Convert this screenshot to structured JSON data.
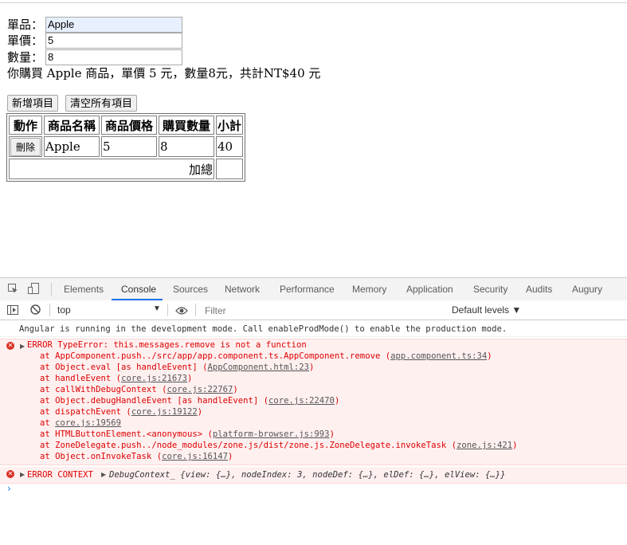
{
  "form": {
    "product_label": "單品：",
    "product_value": "Apple",
    "price_label": "單價：",
    "price_value": "5",
    "qty_label": "數量：",
    "qty_value": "8"
  },
  "summary": "你購買 Apple 商品，單價 5 元，數量8元，共計NT$40 元",
  "buttons": {
    "add": "新增項目",
    "clear": "清空所有項目"
  },
  "table": {
    "headers": [
      "動作",
      "商品名稱",
      "商品價格",
      "購買數量",
      "小計"
    ],
    "row": {
      "delete": "刪除",
      "name": "Apple",
      "price": "5",
      "qty": "8",
      "subtotal": "40"
    },
    "total_label": "加總",
    "total_value": ""
  },
  "devtools": {
    "tabs": [
      "Elements",
      "Console",
      "Sources",
      "Network",
      "Performance",
      "Memory",
      "Application",
      "Security",
      "Audits",
      "Augury"
    ],
    "active_tab": "Console",
    "context": "top",
    "filter_placeholder": "Filter",
    "levels": "Default levels ▼",
    "log_info": "Angular is running in the development mode. Call enableProdMode() to enable the production mode.",
    "error_title": "ERROR TypeError: this.messages.remove is not a function",
    "stack": [
      {
        "pre": "at AppComponent.push../src/app/app.component.ts.AppComponent.remove (",
        "link": "app.component.ts:34",
        "post": ")"
      },
      {
        "pre": "at Object.eval [as handleEvent] (",
        "link": "AppComponent.html:23",
        "post": ")"
      },
      {
        "pre": "at handleEvent (",
        "link": "core.js:21673",
        "post": ")"
      },
      {
        "pre": "at callWithDebugContext (",
        "link": "core.js:22767",
        "post": ")"
      },
      {
        "pre": "at Object.debugHandleEvent [as handleEvent] (",
        "link": "core.js:22470",
        "post": ")"
      },
      {
        "pre": "at dispatchEvent (",
        "link": "core.js:19122",
        "post": ")"
      },
      {
        "pre": "at ",
        "link": "core.js:19569",
        "post": ""
      },
      {
        "pre": "at HTMLButtonElement.<anonymous> (",
        "link": "platform-browser.js:993",
        "post": ")"
      },
      {
        "pre": "at ZoneDelegate.push../node_modules/zone.js/dist/zone.js.ZoneDelegate.invokeTask (",
        "link": "zone.js:421",
        "post": ")"
      },
      {
        "pre": "at Object.onInvokeTask (",
        "link": "core.js:16147",
        "post": ")"
      }
    ],
    "ctx_label": "ERROR CONTEXT",
    "ctx_value": "DebugContext_ {view: {…}, nodeIndex: 3, nodeDef: {…}, elDef: {…}, elView: {…}}"
  }
}
